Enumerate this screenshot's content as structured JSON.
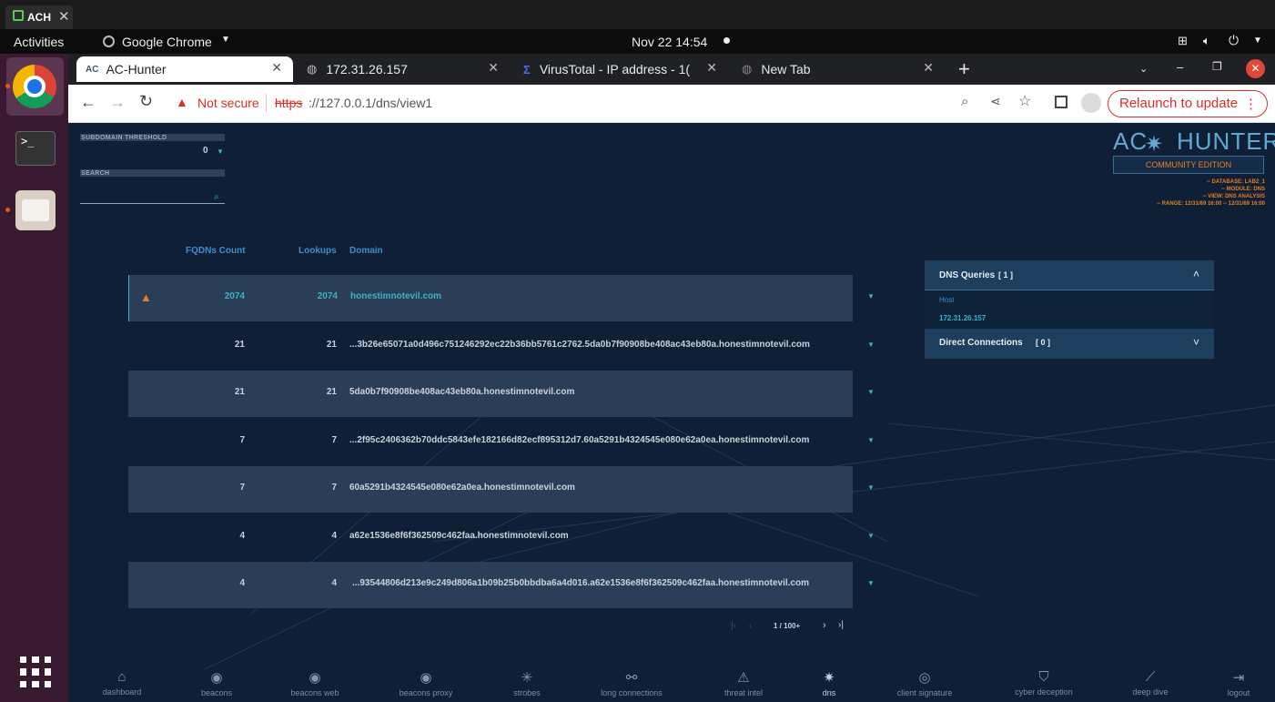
{
  "window_tab": {
    "title": "ACH"
  },
  "gnome": {
    "activities": "Activities",
    "app": "Google Chrome",
    "clock": "Nov 22  14:54"
  },
  "chrome": {
    "tabs": [
      {
        "label": "AC-Hunter",
        "active": true
      },
      {
        "label": "172.31.26.157",
        "active": false
      },
      {
        "label": "VirusTotal - IP address - 1(",
        "active": false
      },
      {
        "label": "New Tab",
        "active": false
      }
    ],
    "not_secure": "Not secure",
    "url_scheme": "https",
    "url_rest": "://127.0.0.1/dns/view1",
    "relaunch": "Relaunch to update"
  },
  "filters": {
    "subdomain_label": "SUBDOMAIN THRESHOLD",
    "subdomain_value": "0",
    "search_label": "SEARCH",
    "search_placeholder": ""
  },
  "logo": {
    "left": "AC",
    "right": "HUNTER",
    "edition": "COMMUNITY EDITION",
    "meta": [
      "-- DATABASE: LAB2_1",
      "-- MODULE: DNS",
      "-- VIEW: DNS ANALYSIS",
      "-- RANGE: 12/31/69 16:00 -- 12/31/69 16:00"
    ]
  },
  "table": {
    "headers": {
      "fqdns": "FQDNs Count",
      "lookups": "Lookups",
      "domain": "Domain"
    },
    "rows": [
      {
        "fqdns": "2074",
        "lookups": "2074",
        "domain": "honestimnotevil.com",
        "warn": true
      },
      {
        "fqdns": "21",
        "lookups": "21",
        "domain": "...3b26e65071a0d496c751246292ec22b36bb5761c2762.5da0b7f90908be408ac43eb80a.honestimnotevil.com"
      },
      {
        "fqdns": "21",
        "lookups": "21",
        "domain": "5da0b7f90908be408ac43eb80a.honestimnotevil.com"
      },
      {
        "fqdns": "7",
        "lookups": "7",
        "domain": "...2f95c2406362b70ddc5843efe182166d82ecf895312d7.60a5291b4324545e080e62a0ea.honestimnotevil.com"
      },
      {
        "fqdns": "7",
        "lookups": "7",
        "domain": "60a5291b4324545e080e62a0ea.honestimnotevil.com"
      },
      {
        "fqdns": "4",
        "lookups": "4",
        "domain": "a62e1536e8f6f362509c462faa.honestimnotevil.com"
      },
      {
        "fqdns": "4",
        "lookups": "4",
        "domain": "...93544806d213e9c249d806a1b09b25b0bbdba6a4d016.a62e1536e8f6f362509c462faa.honestimnotevil.com"
      }
    ]
  },
  "pagination": {
    "label": "1 / 100+"
  },
  "side_panel": {
    "dns_queries": "DNS Queries",
    "dns_queries_count": "[ 1 ]",
    "host_label": "Host",
    "host_value": "172.31.26.157",
    "direct_connections": "Direct Connections",
    "direct_count": "[ 0 ]"
  },
  "bottom_nav": [
    "dashboard",
    "beacons",
    "beacons web",
    "beacons proxy",
    "strobes",
    "long connections",
    "threat intel",
    "dns",
    "client signature",
    "cyber deception",
    "deep dive",
    "logout"
  ],
  "colors": {
    "accent": "#3bb0c9",
    "warn": "#e67e22",
    "bg": "#0e1f36",
    "row_alt": "#2a3f57"
  }
}
